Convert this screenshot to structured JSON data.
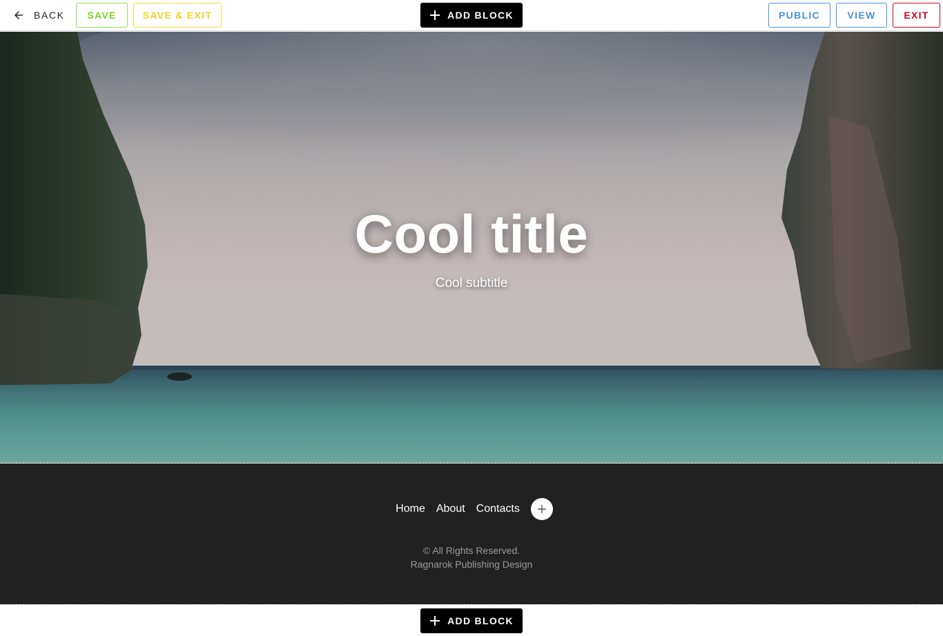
{
  "toolbar": {
    "back_label": "BACK",
    "save_label": "SAVE",
    "save_exit_label": "SAVE & EXIT",
    "add_block_label": "ADD BLOCK",
    "public_label": "PUBLIC",
    "view_label": "VIEW",
    "exit_label": "EXIT"
  },
  "hero": {
    "title": "Cool title",
    "subtitle": "Cool subtitle"
  },
  "footer": {
    "nav": [
      {
        "label": "Home"
      },
      {
        "label": "About"
      },
      {
        "label": "Contacts"
      }
    ],
    "copyright_line1": "© All Rights Reserved.",
    "copyright_line2": "Ragnarok Publishing Design"
  },
  "bottom": {
    "add_block_label": "ADD BLOCK"
  },
  "icons": {
    "back": "arrow-left-icon",
    "add": "plus-icon",
    "nav_add": "plus-icon"
  },
  "colors": {
    "save": "#7ed321",
    "save_exit": "#f0d320",
    "public_view": "#4a90e2",
    "exit": "#d0021b",
    "footer_bg": "#212121"
  }
}
